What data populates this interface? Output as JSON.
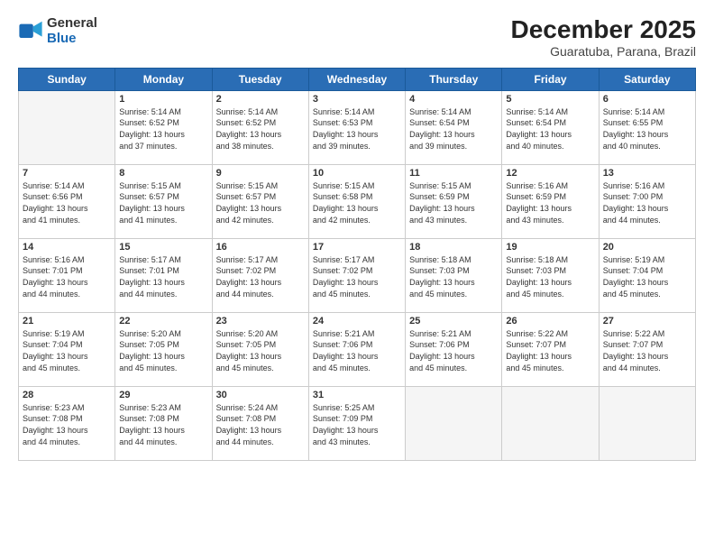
{
  "logo": {
    "general": "General",
    "blue": "Blue"
  },
  "header": {
    "month_year": "December 2025",
    "location": "Guaratuba, Parana, Brazil"
  },
  "weekdays": [
    "Sunday",
    "Monday",
    "Tuesday",
    "Wednesday",
    "Thursday",
    "Friday",
    "Saturday"
  ],
  "weeks": [
    [
      {
        "day": "",
        "info": ""
      },
      {
        "day": "1",
        "info": "Sunrise: 5:14 AM\nSunset: 6:52 PM\nDaylight: 13 hours\nand 37 minutes."
      },
      {
        "day": "2",
        "info": "Sunrise: 5:14 AM\nSunset: 6:52 PM\nDaylight: 13 hours\nand 38 minutes."
      },
      {
        "day": "3",
        "info": "Sunrise: 5:14 AM\nSunset: 6:53 PM\nDaylight: 13 hours\nand 39 minutes."
      },
      {
        "day": "4",
        "info": "Sunrise: 5:14 AM\nSunset: 6:54 PM\nDaylight: 13 hours\nand 39 minutes."
      },
      {
        "day": "5",
        "info": "Sunrise: 5:14 AM\nSunset: 6:54 PM\nDaylight: 13 hours\nand 40 minutes."
      },
      {
        "day": "6",
        "info": "Sunrise: 5:14 AM\nSunset: 6:55 PM\nDaylight: 13 hours\nand 40 minutes."
      }
    ],
    [
      {
        "day": "7",
        "info": "Sunrise: 5:14 AM\nSunset: 6:56 PM\nDaylight: 13 hours\nand 41 minutes."
      },
      {
        "day": "8",
        "info": "Sunrise: 5:15 AM\nSunset: 6:57 PM\nDaylight: 13 hours\nand 41 minutes."
      },
      {
        "day": "9",
        "info": "Sunrise: 5:15 AM\nSunset: 6:57 PM\nDaylight: 13 hours\nand 42 minutes."
      },
      {
        "day": "10",
        "info": "Sunrise: 5:15 AM\nSunset: 6:58 PM\nDaylight: 13 hours\nand 42 minutes."
      },
      {
        "day": "11",
        "info": "Sunrise: 5:15 AM\nSunset: 6:59 PM\nDaylight: 13 hours\nand 43 minutes."
      },
      {
        "day": "12",
        "info": "Sunrise: 5:16 AM\nSunset: 6:59 PM\nDaylight: 13 hours\nand 43 minutes."
      },
      {
        "day": "13",
        "info": "Sunrise: 5:16 AM\nSunset: 7:00 PM\nDaylight: 13 hours\nand 44 minutes."
      }
    ],
    [
      {
        "day": "14",
        "info": "Sunrise: 5:16 AM\nSunset: 7:01 PM\nDaylight: 13 hours\nand 44 minutes."
      },
      {
        "day": "15",
        "info": "Sunrise: 5:17 AM\nSunset: 7:01 PM\nDaylight: 13 hours\nand 44 minutes."
      },
      {
        "day": "16",
        "info": "Sunrise: 5:17 AM\nSunset: 7:02 PM\nDaylight: 13 hours\nand 44 minutes."
      },
      {
        "day": "17",
        "info": "Sunrise: 5:17 AM\nSunset: 7:02 PM\nDaylight: 13 hours\nand 45 minutes."
      },
      {
        "day": "18",
        "info": "Sunrise: 5:18 AM\nSunset: 7:03 PM\nDaylight: 13 hours\nand 45 minutes."
      },
      {
        "day": "19",
        "info": "Sunrise: 5:18 AM\nSunset: 7:03 PM\nDaylight: 13 hours\nand 45 minutes."
      },
      {
        "day": "20",
        "info": "Sunrise: 5:19 AM\nSunset: 7:04 PM\nDaylight: 13 hours\nand 45 minutes."
      }
    ],
    [
      {
        "day": "21",
        "info": "Sunrise: 5:19 AM\nSunset: 7:04 PM\nDaylight: 13 hours\nand 45 minutes."
      },
      {
        "day": "22",
        "info": "Sunrise: 5:20 AM\nSunset: 7:05 PM\nDaylight: 13 hours\nand 45 minutes."
      },
      {
        "day": "23",
        "info": "Sunrise: 5:20 AM\nSunset: 7:05 PM\nDaylight: 13 hours\nand 45 minutes."
      },
      {
        "day": "24",
        "info": "Sunrise: 5:21 AM\nSunset: 7:06 PM\nDaylight: 13 hours\nand 45 minutes."
      },
      {
        "day": "25",
        "info": "Sunrise: 5:21 AM\nSunset: 7:06 PM\nDaylight: 13 hours\nand 45 minutes."
      },
      {
        "day": "26",
        "info": "Sunrise: 5:22 AM\nSunset: 7:07 PM\nDaylight: 13 hours\nand 45 minutes."
      },
      {
        "day": "27",
        "info": "Sunrise: 5:22 AM\nSunset: 7:07 PM\nDaylight: 13 hours\nand 44 minutes."
      }
    ],
    [
      {
        "day": "28",
        "info": "Sunrise: 5:23 AM\nSunset: 7:08 PM\nDaylight: 13 hours\nand 44 minutes."
      },
      {
        "day": "29",
        "info": "Sunrise: 5:23 AM\nSunset: 7:08 PM\nDaylight: 13 hours\nand 44 minutes."
      },
      {
        "day": "30",
        "info": "Sunrise: 5:24 AM\nSunset: 7:08 PM\nDaylight: 13 hours\nand 44 minutes."
      },
      {
        "day": "31",
        "info": "Sunrise: 5:25 AM\nSunset: 7:09 PM\nDaylight: 13 hours\nand 43 minutes."
      },
      {
        "day": "",
        "info": ""
      },
      {
        "day": "",
        "info": ""
      },
      {
        "day": "",
        "info": ""
      }
    ]
  ]
}
